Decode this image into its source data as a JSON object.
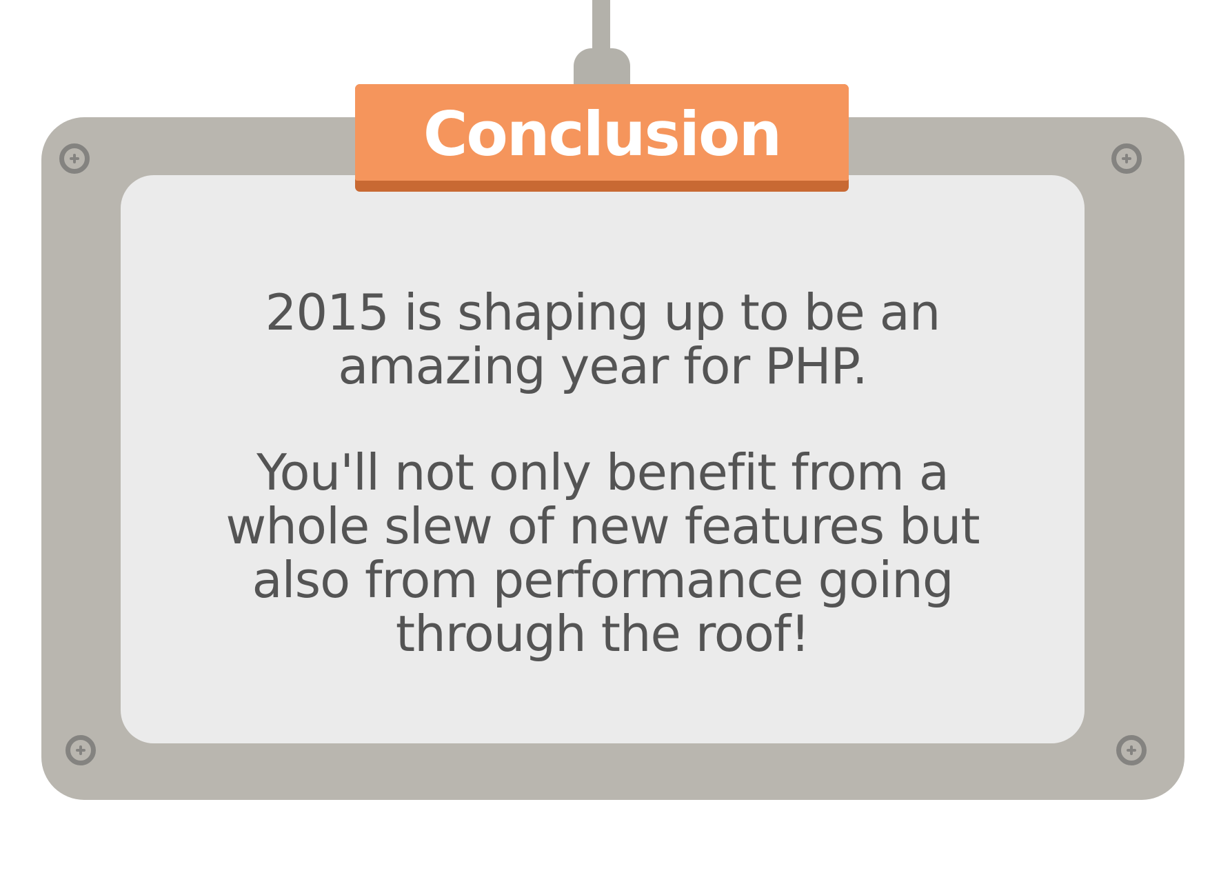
{
  "title": "Conclusion",
  "paragraphs": [
    "2015 is shaping up to be an amazing year for PHP.",
    "You'll not only benefit from a whole slew of new features but also from performance going through the roof!"
  ],
  "colors": {
    "board": "#b9b6af",
    "panel": "#ebebeb",
    "title_plate": "#f5955c",
    "title_plate_shadow": "#c86933",
    "text": "#545454",
    "screw": "#848380"
  },
  "icons": [
    "screw-icon",
    "screw-icon",
    "screw-icon",
    "screw-icon"
  ]
}
